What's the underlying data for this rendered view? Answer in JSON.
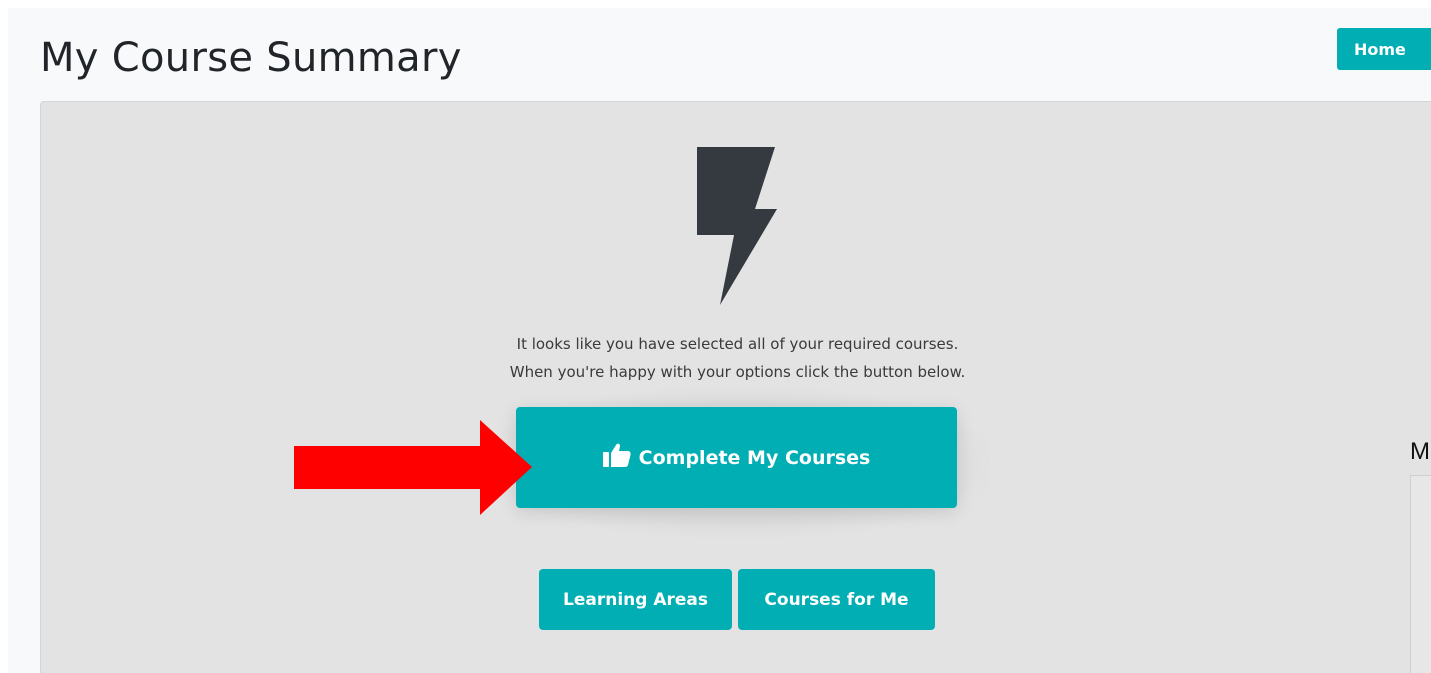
{
  "header": {
    "title": "My Course Summary",
    "home_label": "Home"
  },
  "panel": {
    "message_line1": "It looks like you have selected all of your required courses.",
    "message_line2": "When you're happy with your options click the button below.",
    "complete_label": "Complete My Courses",
    "learning_areas_label": "Learning Areas",
    "courses_for_me_label": "Courses for Me"
  },
  "side": {
    "heading_fragment": "M"
  },
  "icons": {
    "main": "lightning-bolt-icon",
    "button": "thumbs-up-icon",
    "annotation": "red-arrow-icon"
  },
  "colors": {
    "accent": "#00aeb3",
    "panel_background": "#e3e3e3",
    "arrow": "#ff0000",
    "icon_dark": "#343a40"
  }
}
